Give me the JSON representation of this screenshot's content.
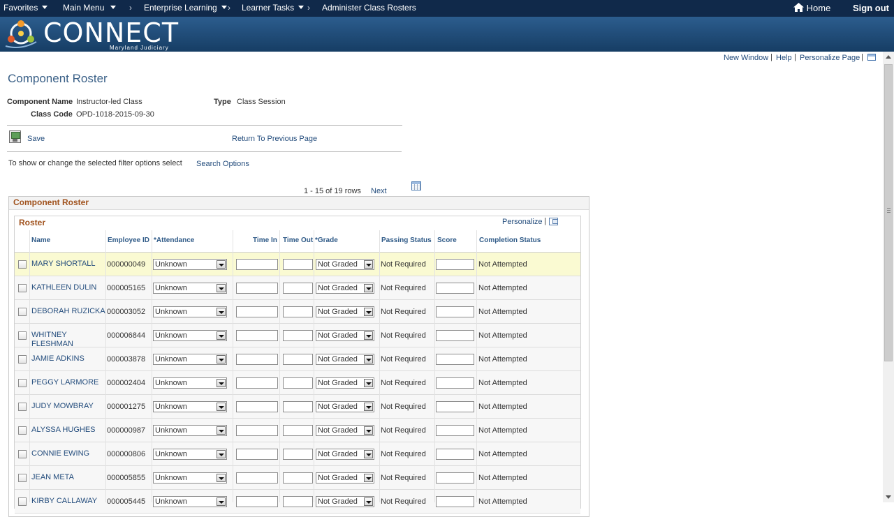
{
  "nav": {
    "favorites": "Favorites",
    "main_menu": "Main Menu",
    "enterprise_learning": "Enterprise Learning",
    "learner_tasks": "Learner Tasks",
    "current_page": "Administer Class Rosters",
    "home": "Home",
    "sign_out": "Sign out",
    "breadcrumb_sep": "›"
  },
  "brand": {
    "logo_text": "CONNECT",
    "logo_sub": "Maryland Judiciary",
    "bar_color": "#10294a"
  },
  "util": {
    "new_window": "New Window",
    "help": "Help",
    "personalize_page": "Personalize Page",
    "sep": "|"
  },
  "page": {
    "title": "Component Roster",
    "component_name_label": "Component Name",
    "component_name": "Instructor-led Class",
    "type_label": "Type",
    "type": "Class Session",
    "class_code_label": "Class Code",
    "class_code": "OPD-1018-2015-09-30",
    "save": "Save",
    "return": "Return To Previous Page",
    "filter_text": "To show or change the selected filter options select",
    "search_options": "Search Options",
    "pagination": "1 - 15 of 19 rows",
    "next": "Next"
  },
  "roster": {
    "outer_title": "Component Roster",
    "inner_title": "Roster",
    "personalize": "Personalize",
    "sep": "|",
    "columns": [
      "Name",
      "Employee ID",
      "*Attendance",
      "Time In",
      "Time Out",
      "*Grade",
      "Passing Status",
      "Score",
      "Completion Status"
    ],
    "rows": [
      {
        "name": "MARY SHORTALL",
        "id": "000000049",
        "attendance": "Unknown",
        "grade": "Not Graded",
        "passing": "Not Required",
        "completion": "Not Attempted"
      },
      {
        "name": "KATHLEEN DULIN",
        "id": "000005165",
        "attendance": "Unknown",
        "grade": "Not Graded",
        "passing": "Not Required",
        "completion": "Not Attempted"
      },
      {
        "name": "DEBORAH RUZICKA",
        "id": "000003052",
        "attendance": "Unknown",
        "grade": "Not Graded",
        "passing": "Not Required",
        "completion": "Not Attempted"
      },
      {
        "name": "WHITNEY FLESHMAN",
        "id": "000006844",
        "attendance": "Unknown",
        "grade": "Not Graded",
        "passing": "Not Required",
        "completion": "Not Attempted"
      },
      {
        "name": "JAMIE ADKINS",
        "id": "000003878",
        "attendance": "Unknown",
        "grade": "Not Graded",
        "passing": "Not Required",
        "completion": "Not Attempted"
      },
      {
        "name": "PEGGY LARMORE",
        "id": "000002404",
        "attendance": "Unknown",
        "grade": "Not Graded",
        "passing": "Not Required",
        "completion": "Not Attempted"
      },
      {
        "name": "JUDY MOWBRAY",
        "id": "000001275",
        "attendance": "Unknown",
        "grade": "Not Graded",
        "passing": "Not Required",
        "completion": "Not Attempted"
      },
      {
        "name": "ALYSSA HUGHES",
        "id": "000000987",
        "attendance": "Unknown",
        "grade": "Not Graded",
        "passing": "Not Required",
        "completion": "Not Attempted"
      },
      {
        "name": "CONNIE EWING",
        "id": "000000806",
        "attendance": "Unknown",
        "grade": "Not Graded",
        "passing": "Not Required",
        "completion": "Not Attempted"
      },
      {
        "name": "JEAN META",
        "id": "000005855",
        "attendance": "Unknown",
        "grade": "Not Graded",
        "passing": "Not Required",
        "completion": "Not Attempted"
      },
      {
        "name": "KIRBY CALLAWAY",
        "id": "000005445",
        "attendance": "Unknown",
        "grade": "Not Graded",
        "passing": "Not Required",
        "completion": "Not Attempted"
      }
    ]
  }
}
